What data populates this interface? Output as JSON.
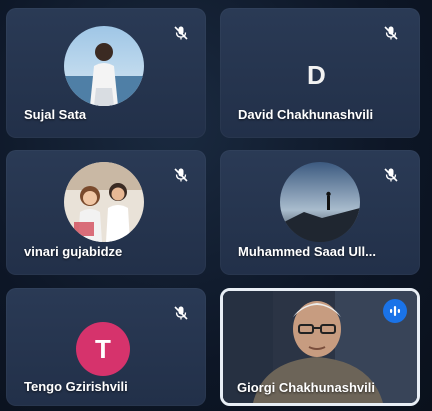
{
  "participants": [
    {
      "name": "Sujal Sata",
      "avatar": "photo",
      "muted": true,
      "mic_icon": "mic-off-icon"
    },
    {
      "name": "David Chakhunashvili",
      "avatar": "letter",
      "letter": "D",
      "muted": true,
      "mic_icon": "mic-off-icon"
    },
    {
      "name": "vinari gujabidze",
      "avatar": "photo",
      "muted": true,
      "mic_icon": "mic-off-icon"
    },
    {
      "name": "Muhammed Saad Ull...",
      "avatar": "photo",
      "muted": true,
      "mic_icon": "mic-off-icon"
    },
    {
      "name": "Tengo Gzirishvili",
      "avatar": "letter",
      "letter": "T",
      "letter_color": "#d6336c",
      "muted": true,
      "mic_icon": "mic-off-icon"
    },
    {
      "name": "Giorgi Chakhunashvili",
      "avatar": "video",
      "speaking": true,
      "speaking_icon": "audio-level-icon"
    }
  ],
  "colors": {
    "tile_bg": "#2a3a55",
    "speaking_border": "#e8eef5",
    "accent_blue": "#1a73e8"
  }
}
